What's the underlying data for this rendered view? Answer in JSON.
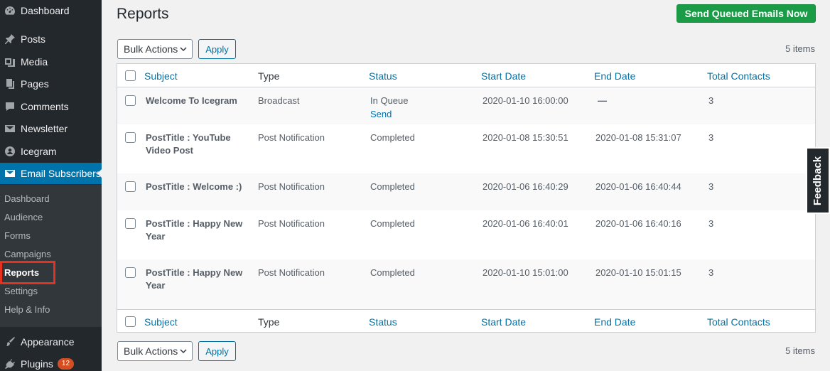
{
  "sidebar": {
    "items": [
      {
        "label": "Dashboard",
        "icon": "dashboard-icon"
      },
      {
        "label": "Posts",
        "icon": "pin-icon"
      },
      {
        "label": "Media",
        "icon": "media-icon"
      },
      {
        "label": "Pages",
        "icon": "pages-icon"
      },
      {
        "label": "Comments",
        "icon": "comment-icon"
      },
      {
        "label": "Newsletter",
        "icon": "mail-icon"
      },
      {
        "label": "Icegram",
        "icon": "icegram-icon"
      },
      {
        "label": "Email Subscribers",
        "icon": "envelope-icon",
        "active": true
      }
    ],
    "submenu": [
      "Dashboard",
      "Audience",
      "Forms",
      "Campaigns",
      "Reports",
      "Settings",
      "Help & Info"
    ],
    "bottom": [
      {
        "label": "Appearance",
        "icon": "brush-icon"
      },
      {
        "label": "Plugins",
        "icon": "plug-icon",
        "badge": "12"
      }
    ]
  },
  "page": {
    "title": "Reports",
    "send_button": "Send Queued Emails Now",
    "bulk_actions": "Bulk Actions",
    "apply": "Apply",
    "items_count": "5 items"
  },
  "table": {
    "columns": [
      "Subject",
      "Type",
      "Status",
      "Start Date",
      "End Date",
      "Total Contacts"
    ],
    "rows": [
      {
        "subject": "Welcome To Icegram",
        "type": "Broadcast",
        "status": "In Queue",
        "action": "Send",
        "start": "2020-01-10 16:00:00",
        "end": "—",
        "contacts": "3"
      },
      {
        "subject": "PostTitle : YouTube Video Post",
        "type": "Post Notification",
        "status": "Completed",
        "start": "2020-01-08 15:30:51",
        "end": "2020-01-08 15:31:07",
        "contacts": "3"
      },
      {
        "subject": "PostTitle : Welcome :)",
        "type": "Post Notification",
        "status": "Completed",
        "start": "2020-01-06 16:40:29",
        "end": "2020-01-06 16:40:44",
        "contacts": "3"
      },
      {
        "subject": "PostTitle : Happy New Year",
        "type": "Post Notification",
        "status": "Completed",
        "start": "2020-01-06 16:40:01",
        "end": "2020-01-06 16:40:16",
        "contacts": "3"
      },
      {
        "subject": "PostTitle : Happy New Year",
        "type": "Post Notification",
        "status": "Completed",
        "start": "2020-01-10 15:01:00",
        "end": "2020-01-10 15:01:15",
        "contacts": "3"
      }
    ]
  },
  "feedback": "Feedback",
  "colors": {
    "accent": "#0073aa",
    "send_button": "#1a9c46",
    "sidebar": "#23282d",
    "highlight": "#e5321e"
  }
}
